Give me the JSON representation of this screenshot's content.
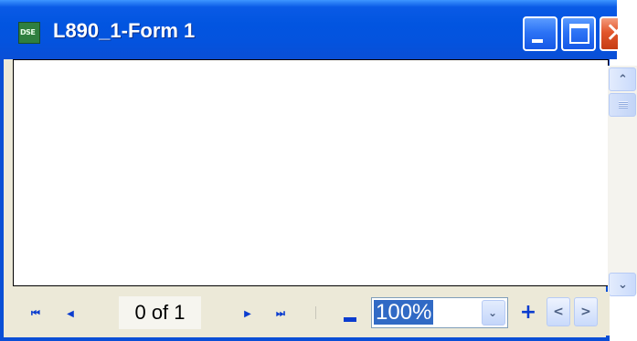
{
  "window": {
    "title": "L890_1-Form 1",
    "icon": "dse-app-icon",
    "icon_text": "DSE"
  },
  "titlebar_buttons": {
    "minimize_icon": "minimize-icon",
    "maximize_icon": "maximize-icon",
    "close_icon": "close-icon",
    "close_glyph": "✕"
  },
  "scrollbar": {
    "up_glyph": "⌃",
    "down_glyph": "⌄"
  },
  "toolbar": {
    "first_glyph": "⏮",
    "prev_glyph": "◀",
    "page_label": "0 of 1",
    "next_glyph": "▶",
    "last_glyph": "⏭",
    "zoom_value": "100%",
    "zoom_drop_glyph": "⌄",
    "zoom_plus_glyph": "+",
    "left_glyph": "<",
    "right_glyph": ">"
  },
  "colors": {
    "titlebar": "#0a4fd6",
    "toolbar": "#ece9d8",
    "selection": "#316ac5",
    "close_button": "#e2562b"
  }
}
